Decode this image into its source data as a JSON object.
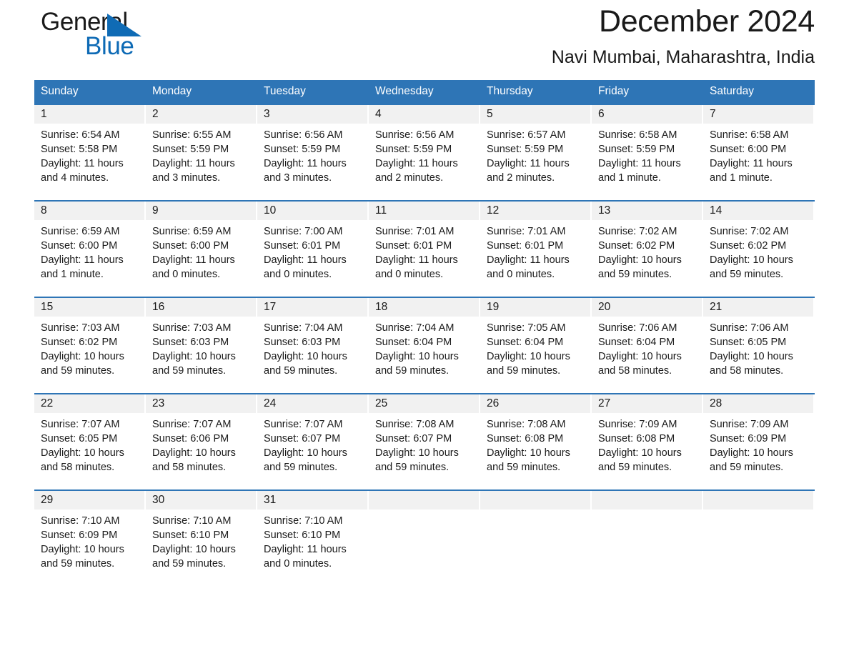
{
  "brand": {
    "name_part1": "General",
    "name_part2": "Blue",
    "logo_icon": "triangle-icon",
    "accent_color": "#0d6ab5"
  },
  "header": {
    "title": "December 2024",
    "subtitle": "Navi Mumbai, Maharashtra, India"
  },
  "theme": {
    "header_blue": "#2e75b6",
    "daynum_gray": "#f1f1f1",
    "text_color": "#1a1a1a"
  },
  "calendar": {
    "day_headers": [
      "Sunday",
      "Monday",
      "Tuesday",
      "Wednesday",
      "Thursday",
      "Friday",
      "Saturday"
    ],
    "weeks": [
      [
        {
          "day": "1",
          "sunrise": "Sunrise: 6:54 AM",
          "sunset": "Sunset: 5:58 PM",
          "daylight1": "Daylight: 11 hours",
          "daylight2": "and 4 minutes."
        },
        {
          "day": "2",
          "sunrise": "Sunrise: 6:55 AM",
          "sunset": "Sunset: 5:59 PM",
          "daylight1": "Daylight: 11 hours",
          "daylight2": "and 3 minutes."
        },
        {
          "day": "3",
          "sunrise": "Sunrise: 6:56 AM",
          "sunset": "Sunset: 5:59 PM",
          "daylight1": "Daylight: 11 hours",
          "daylight2": "and 3 minutes."
        },
        {
          "day": "4",
          "sunrise": "Sunrise: 6:56 AM",
          "sunset": "Sunset: 5:59 PM",
          "daylight1": "Daylight: 11 hours",
          "daylight2": "and 2 minutes."
        },
        {
          "day": "5",
          "sunrise": "Sunrise: 6:57 AM",
          "sunset": "Sunset: 5:59 PM",
          "daylight1": "Daylight: 11 hours",
          "daylight2": "and 2 minutes."
        },
        {
          "day": "6",
          "sunrise": "Sunrise: 6:58 AM",
          "sunset": "Sunset: 5:59 PM",
          "daylight1": "Daylight: 11 hours",
          "daylight2": "and 1 minute."
        },
        {
          "day": "7",
          "sunrise": "Sunrise: 6:58 AM",
          "sunset": "Sunset: 6:00 PM",
          "daylight1": "Daylight: 11 hours",
          "daylight2": "and 1 minute."
        }
      ],
      [
        {
          "day": "8",
          "sunrise": "Sunrise: 6:59 AM",
          "sunset": "Sunset: 6:00 PM",
          "daylight1": "Daylight: 11 hours",
          "daylight2": "and 1 minute."
        },
        {
          "day": "9",
          "sunrise": "Sunrise: 6:59 AM",
          "sunset": "Sunset: 6:00 PM",
          "daylight1": "Daylight: 11 hours",
          "daylight2": "and 0 minutes."
        },
        {
          "day": "10",
          "sunrise": "Sunrise: 7:00 AM",
          "sunset": "Sunset: 6:01 PM",
          "daylight1": "Daylight: 11 hours",
          "daylight2": "and 0 minutes."
        },
        {
          "day": "11",
          "sunrise": "Sunrise: 7:01 AM",
          "sunset": "Sunset: 6:01 PM",
          "daylight1": "Daylight: 11 hours",
          "daylight2": "and 0 minutes."
        },
        {
          "day": "12",
          "sunrise": "Sunrise: 7:01 AM",
          "sunset": "Sunset: 6:01 PM",
          "daylight1": "Daylight: 11 hours",
          "daylight2": "and 0 minutes."
        },
        {
          "day": "13",
          "sunrise": "Sunrise: 7:02 AM",
          "sunset": "Sunset: 6:02 PM",
          "daylight1": "Daylight: 10 hours",
          "daylight2": "and 59 minutes."
        },
        {
          "day": "14",
          "sunrise": "Sunrise: 7:02 AM",
          "sunset": "Sunset: 6:02 PM",
          "daylight1": "Daylight: 10 hours",
          "daylight2": "and 59 minutes."
        }
      ],
      [
        {
          "day": "15",
          "sunrise": "Sunrise: 7:03 AM",
          "sunset": "Sunset: 6:02 PM",
          "daylight1": "Daylight: 10 hours",
          "daylight2": "and 59 minutes."
        },
        {
          "day": "16",
          "sunrise": "Sunrise: 7:03 AM",
          "sunset": "Sunset: 6:03 PM",
          "daylight1": "Daylight: 10 hours",
          "daylight2": "and 59 minutes."
        },
        {
          "day": "17",
          "sunrise": "Sunrise: 7:04 AM",
          "sunset": "Sunset: 6:03 PM",
          "daylight1": "Daylight: 10 hours",
          "daylight2": "and 59 minutes."
        },
        {
          "day": "18",
          "sunrise": "Sunrise: 7:04 AM",
          "sunset": "Sunset: 6:04 PM",
          "daylight1": "Daylight: 10 hours",
          "daylight2": "and 59 minutes."
        },
        {
          "day": "19",
          "sunrise": "Sunrise: 7:05 AM",
          "sunset": "Sunset: 6:04 PM",
          "daylight1": "Daylight: 10 hours",
          "daylight2": "and 59 minutes."
        },
        {
          "day": "20",
          "sunrise": "Sunrise: 7:06 AM",
          "sunset": "Sunset: 6:04 PM",
          "daylight1": "Daylight: 10 hours",
          "daylight2": "and 58 minutes."
        },
        {
          "day": "21",
          "sunrise": "Sunrise: 7:06 AM",
          "sunset": "Sunset: 6:05 PM",
          "daylight1": "Daylight: 10 hours",
          "daylight2": "and 58 minutes."
        }
      ],
      [
        {
          "day": "22",
          "sunrise": "Sunrise: 7:07 AM",
          "sunset": "Sunset: 6:05 PM",
          "daylight1": "Daylight: 10 hours",
          "daylight2": "and 58 minutes."
        },
        {
          "day": "23",
          "sunrise": "Sunrise: 7:07 AM",
          "sunset": "Sunset: 6:06 PM",
          "daylight1": "Daylight: 10 hours",
          "daylight2": "and 58 minutes."
        },
        {
          "day": "24",
          "sunrise": "Sunrise: 7:07 AM",
          "sunset": "Sunset: 6:07 PM",
          "daylight1": "Daylight: 10 hours",
          "daylight2": "and 59 minutes."
        },
        {
          "day": "25",
          "sunrise": "Sunrise: 7:08 AM",
          "sunset": "Sunset: 6:07 PM",
          "daylight1": "Daylight: 10 hours",
          "daylight2": "and 59 minutes."
        },
        {
          "day": "26",
          "sunrise": "Sunrise: 7:08 AM",
          "sunset": "Sunset: 6:08 PM",
          "daylight1": "Daylight: 10 hours",
          "daylight2": "and 59 minutes."
        },
        {
          "day": "27",
          "sunrise": "Sunrise: 7:09 AM",
          "sunset": "Sunset: 6:08 PM",
          "daylight1": "Daylight: 10 hours",
          "daylight2": "and 59 minutes."
        },
        {
          "day": "28",
          "sunrise": "Sunrise: 7:09 AM",
          "sunset": "Sunset: 6:09 PM",
          "daylight1": "Daylight: 10 hours",
          "daylight2": "and 59 minutes."
        }
      ],
      [
        {
          "day": "29",
          "sunrise": "Sunrise: 7:10 AM",
          "sunset": "Sunset: 6:09 PM",
          "daylight1": "Daylight: 10 hours",
          "daylight2": "and 59 minutes."
        },
        {
          "day": "30",
          "sunrise": "Sunrise: 7:10 AM",
          "sunset": "Sunset: 6:10 PM",
          "daylight1": "Daylight: 10 hours",
          "daylight2": "and 59 minutes."
        },
        {
          "day": "31",
          "sunrise": "Sunrise: 7:10 AM",
          "sunset": "Sunset: 6:10 PM",
          "daylight1": "Daylight: 11 hours",
          "daylight2": "and 0 minutes."
        },
        {
          "day": "",
          "sunrise": "",
          "sunset": "",
          "daylight1": "",
          "daylight2": ""
        },
        {
          "day": "",
          "sunrise": "",
          "sunset": "",
          "daylight1": "",
          "daylight2": ""
        },
        {
          "day": "",
          "sunrise": "",
          "sunset": "",
          "daylight1": "",
          "daylight2": ""
        },
        {
          "day": "",
          "sunrise": "",
          "sunset": "",
          "daylight1": "",
          "daylight2": ""
        }
      ]
    ]
  }
}
